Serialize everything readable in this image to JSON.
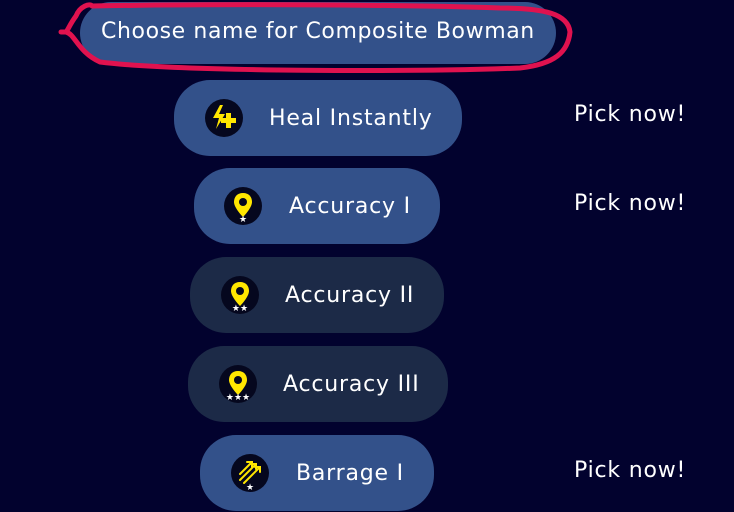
{
  "header": {
    "title": "Choose name for Composite Bowman"
  },
  "skills": [
    {
      "label": "Heal Instantly",
      "icon": "heal-bolt-plus-icon",
      "status": "unlocked",
      "pick_label": "Pick now!"
    },
    {
      "label": "Accuracy I",
      "icon": "accuracy-pin-1-star-icon",
      "status": "unlocked",
      "pick_label": "Pick now!"
    },
    {
      "label": "Accuracy II",
      "icon": "accuracy-pin-2-star-icon",
      "status": "locked",
      "pick_label": ""
    },
    {
      "label": "Accuracy III",
      "icon": "accuracy-pin-3-star-icon",
      "status": "locked",
      "pick_label": ""
    },
    {
      "label": "Barrage I",
      "icon": "barrage-arrows-1-star-icon",
      "status": "unlocked",
      "pick_label": "Pick now!"
    }
  ],
  "colors": {
    "background": "#02022e",
    "pill_unlocked": "#33518a",
    "pill_locked": "#1c2a47",
    "icon_yellow": "#ffe600",
    "highlight_red": "#e0124f"
  }
}
